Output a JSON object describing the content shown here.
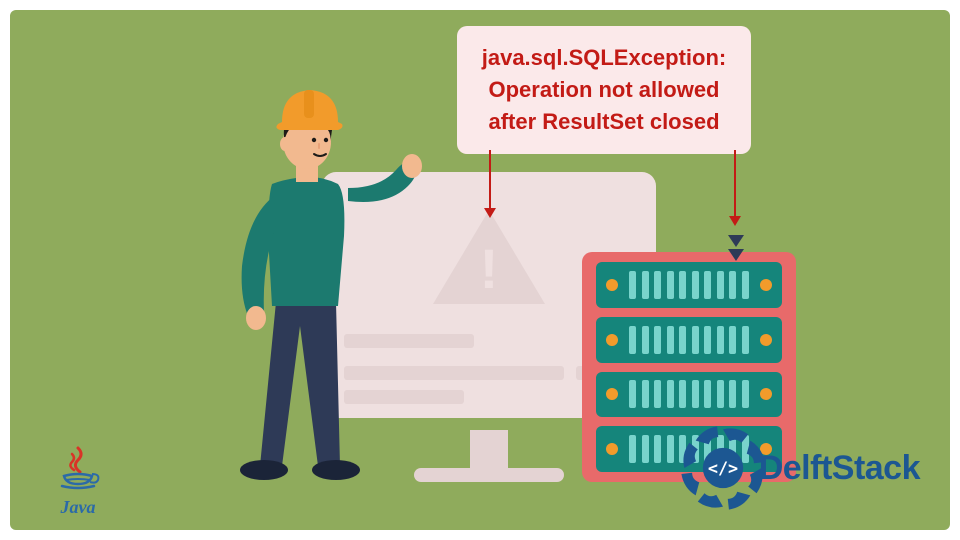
{
  "callout": {
    "line1": "java.sql.SQLException:",
    "line2": "Operation not allowed",
    "line3": "after ResultSet closed"
  },
  "monitor": {
    "warning_symbol": "!"
  },
  "logos": {
    "java": "Java",
    "delftstack": "DelftStack"
  }
}
